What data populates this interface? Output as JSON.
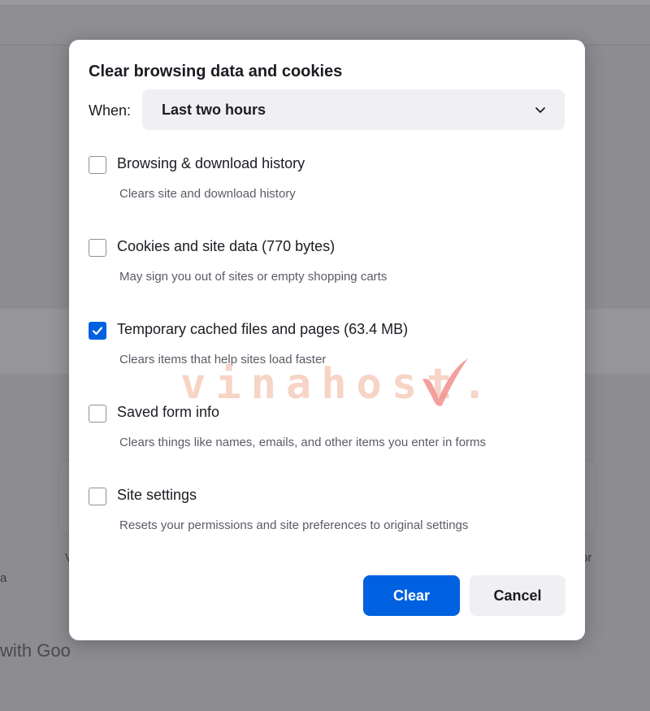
{
  "background": {
    "search_fragment": "with Goo",
    "fragments": {
      "left_a": "a",
      "left_v": "V",
      "right_or": "or"
    }
  },
  "dialog": {
    "title": "Clear browsing data and cookies",
    "when_label": "When:",
    "when_value": "Last two hours",
    "options": [
      {
        "label": "Browsing & download history",
        "description": "Clears site and download history",
        "checked": false
      },
      {
        "label": "Cookies and site data (770 bytes)",
        "description": "May sign you out of sites or empty shopping carts",
        "checked": false
      },
      {
        "label": "Temporary cached files and pages (63.4 MB)",
        "description": "Clears items that help sites load faster",
        "checked": true
      },
      {
        "label": "Saved form info",
        "description": "Clears things like names, emails, and other items you enter in forms",
        "checked": false
      },
      {
        "label": "Site settings",
        "description": "Resets your permissions and site preferences to original settings",
        "checked": false
      }
    ],
    "clear_label": "Clear",
    "cancel_label": "Cancel"
  },
  "watermark": {
    "text": "vinahost."
  },
  "colors": {
    "accent": "#0061e0",
    "watermark": "#f3c6b3",
    "overlay": "#8d8c91"
  },
  "icons": {
    "select": "chevron-down-icon",
    "checked": "checkmark-icon",
    "watermark": "checkmark-logo-icon"
  }
}
